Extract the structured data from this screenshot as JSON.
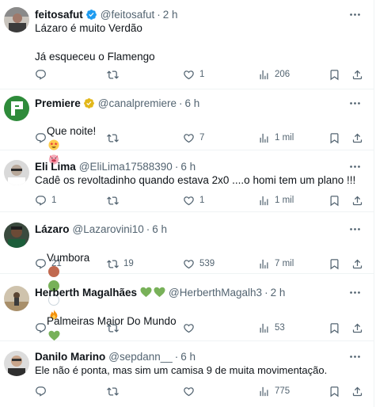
{
  "tweets": [
    {
      "name": "feitosafut",
      "handle": "@feitosafut",
      "time": "2 h",
      "verified": "blue",
      "text": "Lázaro é muito Verdão\n\nJá esqueceu o Flamengo",
      "replies": "",
      "retweets": "",
      "likes": "1",
      "views": "206"
    },
    {
      "name": "Premiere",
      "handle": "@canalpremiere",
      "time": "6 h",
      "verified": "gold",
      "text": "Que noite!",
      "emoji": [
        "star-struck-face",
        "pig-face"
      ],
      "replies": "",
      "retweets": "",
      "likes": "7",
      "views": "1 mil"
    },
    {
      "name": "Eli Lima",
      "handle": "@EliLima17588390",
      "time": "6 h",
      "text": "Cadê os revoltadinho quando estava 2x0 ....o homi tem um plano !!!",
      "replies": "1",
      "retweets": "",
      "likes": "1",
      "views": "1 mil"
    },
    {
      "name": "Lázaro",
      "handle": "@Lazarovini10",
      "time": "6 h",
      "text": "Vumbora",
      "emoji": [
        "brown-circle",
        "green-circle",
        "white-circle",
        "fire"
      ],
      "replies": "21",
      "retweets": "19",
      "likes": "539",
      "views": "7 mil"
    },
    {
      "name": "Herberth Magalhães",
      "name_emoji": [
        "green-heart",
        "green-heart"
      ],
      "handle": "@HerberthMagalh3",
      "time": "2 h",
      "text": "Palmeiras Maior Do Mundo",
      "emoji": [
        "green-heart"
      ],
      "replies": "",
      "retweets": "",
      "likes": "",
      "views": "53"
    },
    {
      "name": "Danilo Marino",
      "handle": "@sepdann__",
      "time": "6 h",
      "text": "Ele não é ponta, mas sim um camisa 9 de muita movimentação.",
      "replies": "",
      "retweets": "",
      "likes": "",
      "views": "775"
    }
  ],
  "colors": {
    "text": "#0f1419",
    "secondary": "#536471",
    "border": "#eff3f4",
    "verified_blue": "#1d9bf0",
    "verified_gold": "#e2b719",
    "emoji_green": "#78b159"
  }
}
